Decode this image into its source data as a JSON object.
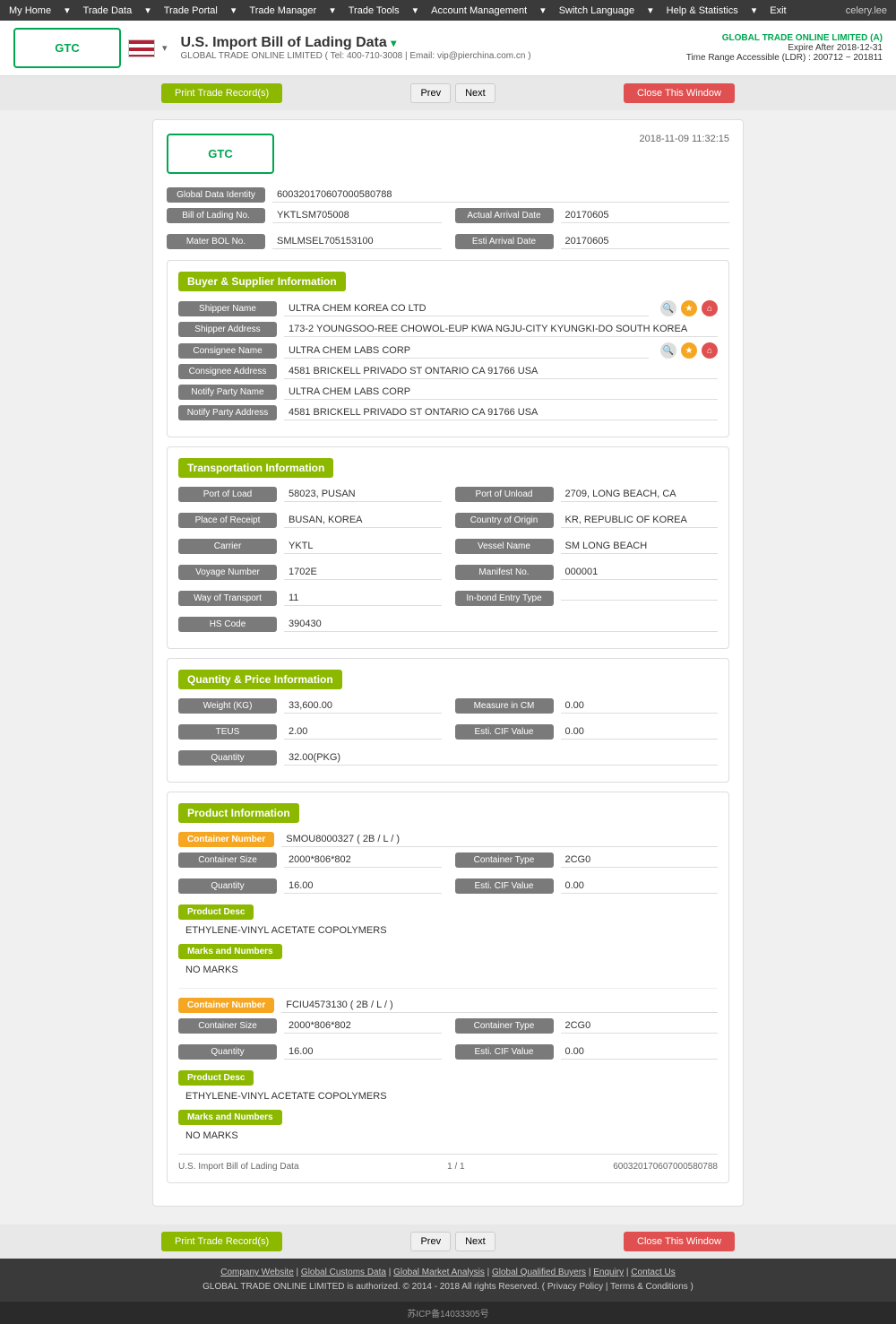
{
  "nav": {
    "items": [
      "My Home",
      "Trade Data",
      "Trade Portal",
      "Trade Manager",
      "Trade Tools",
      "Account Management",
      "Switch Language",
      "Help & Statistics",
      "Exit"
    ],
    "user": "celery.lee"
  },
  "header": {
    "logo_text": "GTC",
    "title": "U.S. Import Bill of Lading Data",
    "company_tel": "GLOBAL TRADE ONLINE LIMITED ( Tel: 400-710-3008 | Email: vip@pierchina.com.cn )",
    "company_link": "GLOBAL TRADE ONLINE LIMITED (A)",
    "expire": "Expire After 2018-12-31",
    "time_range": "Time Range Accessible (LDR) : 200712 ~ 201811"
  },
  "toolbar": {
    "print_label": "Print Trade Record(s)",
    "prev_label": "Prev",
    "next_label": "Next",
    "close_label": "Close This Window"
  },
  "record": {
    "timestamp": "2018-11-09 11:32:15",
    "global_data_identity_label": "Global Data Identity",
    "global_data_identity_value": "600320170607000580788",
    "bill_of_lading_label": "Bill of Lading No.",
    "bill_of_lading_value": "YKTLSM705008",
    "actual_arrival_label": "Actual Arrival Date",
    "actual_arrival_value": "20170605",
    "master_bol_label": "Mater BOL No.",
    "master_bol_value": "SMLMSEL705153100",
    "esti_arrival_label": "Esti Arrival Date",
    "esti_arrival_value": "20170605"
  },
  "buyer_supplier": {
    "section_title": "Buyer & Supplier Information",
    "shipper_name_label": "Shipper Name",
    "shipper_name_value": "ULTRA CHEM KOREA CO LTD",
    "shipper_address_label": "Shipper Address",
    "shipper_address_value": "173-2 YOUNGSOO-REE CHOWOL-EUP KWA NGJU-CITY KYUNGKI-DO SOUTH KOREA",
    "consignee_name_label": "Consignee Name",
    "consignee_name_value": "ULTRA CHEM LABS CORP",
    "consignee_address_label": "Consignee Address",
    "consignee_address_value": "4581 BRICKELL PRIVADO ST ONTARIO CA 91766 USA",
    "notify_party_name_label": "Notify Party Name",
    "notify_party_name_value": "ULTRA CHEM LABS CORP",
    "notify_party_address_label": "Notify Party Address",
    "notify_party_address_value": "4581 BRICKELL PRIVADO ST ONTARIO CA 91766 USA"
  },
  "transportation": {
    "section_title": "Transportation Information",
    "port_of_load_label": "Port of Load",
    "port_of_load_value": "58023, PUSAN",
    "port_of_unload_label": "Port of Unload",
    "port_of_unload_value": "2709, LONG BEACH, CA",
    "place_of_receipt_label": "Place of Receipt",
    "place_of_receipt_value": "BUSAN, KOREA",
    "country_of_origin_label": "Country of Origin",
    "country_of_origin_value": "KR, REPUBLIC OF KOREA",
    "carrier_label": "Carrier",
    "carrier_value": "YKTL",
    "vessel_name_label": "Vessel Name",
    "vessel_name_value": "SM LONG BEACH",
    "voyage_number_label": "Voyage Number",
    "voyage_number_value": "1702E",
    "manifest_no_label": "Manifest No.",
    "manifest_no_value": "000001",
    "way_of_transport_label": "Way of Transport",
    "way_of_transport_value": "11",
    "inbond_entry_label": "In-bond Entry Type",
    "inbond_entry_value": "",
    "hs_code_label": "HS Code",
    "hs_code_value": "390430"
  },
  "quantity_price": {
    "section_title": "Quantity & Price Information",
    "weight_label": "Weight (KG)",
    "weight_value": "33,600.00",
    "measure_cm_label": "Measure in CM",
    "measure_cm_value": "0.00",
    "teus_label": "TEUS",
    "teus_value": "2.00",
    "esti_cif_label": "Esti. CIF Value",
    "esti_cif_value": "0.00",
    "quantity_label": "Quantity",
    "quantity_value": "32.00(PKG)"
  },
  "product": {
    "section_title": "Product Information",
    "container1": {
      "number_label": "Container Number",
      "number_value": "SMOU8000327 ( 2B / L / )",
      "size_label": "Container Size",
      "size_value": "2000*806*802",
      "type_label": "Container Type",
      "type_value": "2CG0",
      "quantity_label": "Quantity",
      "quantity_value": "16.00",
      "esti_cif_label": "Esti. CIF Value",
      "esti_cif_value": "0.00",
      "product_desc_label": "Product Desc",
      "product_desc_value": "ETHYLENE-VINYL ACETATE COPOLYMERS",
      "marks_label": "Marks and Numbers",
      "marks_value": "NO MARKS"
    },
    "container2": {
      "number_label": "Container Number",
      "number_value": "FCIU4573130 ( 2B / L / )",
      "size_label": "Container Size",
      "size_value": "2000*806*802",
      "type_label": "Container Type",
      "type_value": "2CG0",
      "quantity_label": "Quantity",
      "quantity_value": "16.00",
      "esti_cif_label": "Esti. CIF Value",
      "esti_cif_value": "0.00",
      "product_desc_label": "Product Desc",
      "product_desc_value": "ETHYLENE-VINYL ACETATE COPOLYMERS",
      "marks_label": "Marks and Numbers",
      "marks_value": "NO MARKS"
    }
  },
  "card_footer": {
    "left": "U.S. Import Bill of Lading Data",
    "center": "1 / 1",
    "right": "600320170607000580788"
  },
  "footer": {
    "links": [
      "Company Website",
      "Global Customs Data",
      "Global Market Analysis",
      "Global Qualified Buyers",
      "Enquiry",
      "Contact Us"
    ],
    "copyright": "GLOBAL TRADE ONLINE LIMITED is authorized. © 2014 - 2018 All rights Reserved.  (  Privacy Policy  |  Terms & Conditions  )",
    "icp": "苏ICP备14033305号"
  }
}
